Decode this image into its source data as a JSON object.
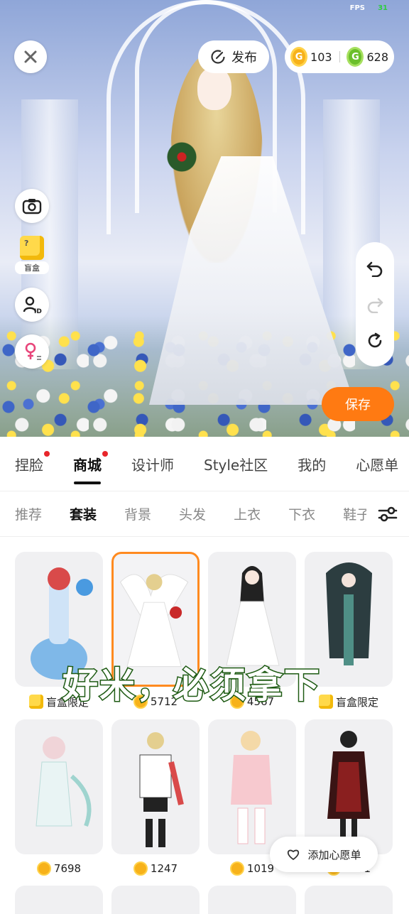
{
  "status": {
    "fps_label": "FPS",
    "fps_value": "31"
  },
  "topbar": {
    "publish_label": "发布",
    "gold_coins": "103",
    "green_coins": "628"
  },
  "sidebar": {
    "blindbox_label": "盲盒",
    "blindbox_icon_text": "?"
  },
  "save_label": "保存",
  "main_tabs": [
    {
      "label": "捏脸",
      "dot": true
    },
    {
      "label": "商城",
      "dot": true,
      "active": true
    },
    {
      "label": "设计师"
    },
    {
      "label": "Style社区"
    },
    {
      "label": "我的"
    },
    {
      "label": "心愿单"
    }
  ],
  "sub_tabs": [
    {
      "label": "推荐"
    },
    {
      "label": "套装",
      "active": true
    },
    {
      "label": "背景"
    },
    {
      "label": "头发"
    },
    {
      "label": "上衣"
    },
    {
      "label": "下衣"
    },
    {
      "label": "鞋子"
    }
  ],
  "items": [
    {
      "price": "盲盒限定",
      "type": "blindbox"
    },
    {
      "price": "5712",
      "type": "coin",
      "selected": true
    },
    {
      "price": "4567",
      "type": "coin"
    },
    {
      "price": "盲盒限定",
      "type": "blindbox"
    },
    {
      "price": "7698",
      "type": "coin"
    },
    {
      "price": "1247",
      "type": "coin"
    },
    {
      "price": "1019",
      "type": "coin"
    },
    {
      "price": "1991",
      "type": "coin"
    }
  ],
  "caption": "好米，必须拿下",
  "wishlist_add_label": "添加心愿单",
  "colors": {
    "accent": "#ff7a12",
    "selected_border": "#ff8a1f",
    "badge_dot": "#e8262b"
  },
  "icons": [
    "close-icon",
    "publish-icon",
    "gold-coin-icon",
    "green-coin-icon",
    "camera-icon",
    "blindbox-icon",
    "id-card-icon",
    "gender-icon",
    "undo-icon",
    "redo-icon",
    "reset-icon",
    "filter-icon",
    "heart-icon"
  ]
}
